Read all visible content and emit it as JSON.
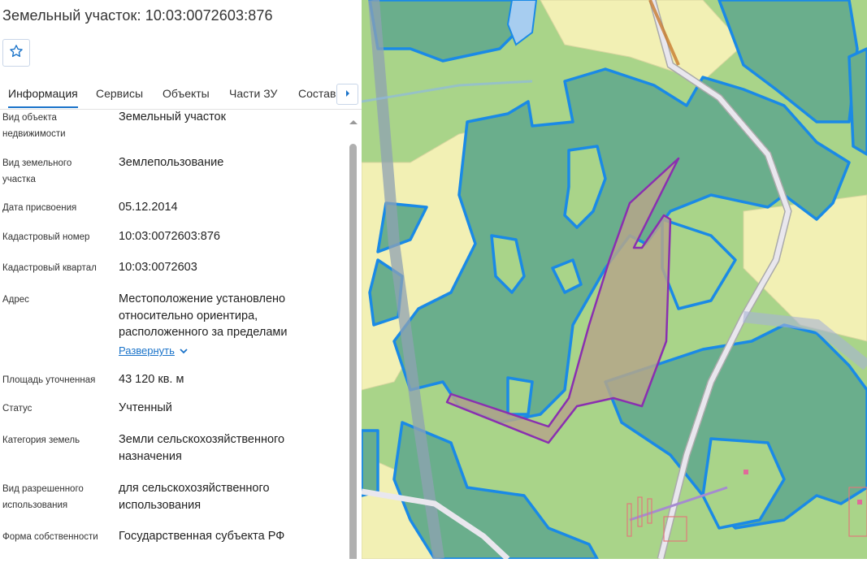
{
  "panel": {
    "title": "Земельный участок: 10:03:0072603:876",
    "favorite_icon": "star-outline-icon",
    "tabs": [
      {
        "label": "Информация",
        "active": true
      },
      {
        "label": "Сервисы",
        "active": false
      },
      {
        "label": "Объекты",
        "active": false
      },
      {
        "label": "Части ЗУ",
        "active": false
      },
      {
        "label": "Состав",
        "active": false
      }
    ],
    "tabs_next_icon": "caret-right-icon",
    "fields": [
      {
        "label": "Вид объекта недвижимости",
        "value": "Земельный участок"
      },
      {
        "label": "Вид земельного участка",
        "value": "Землепользование"
      },
      {
        "label": "Дата присвоения",
        "value": "05.12.2014"
      },
      {
        "label": "Кадастровый номер",
        "value": "10:03:0072603:876"
      },
      {
        "label": "Кадастровый квартал",
        "value": "10:03:0072603"
      },
      {
        "label": "Адрес",
        "value": "Местоположение установлено относительно ориентира, расположенного за пределами"
      },
      {
        "label": "Площадь уточненная",
        "value": "43 120 кв. м"
      },
      {
        "label": "Статус",
        "value": "Учтенный"
      },
      {
        "label": "Категория земель",
        "value": "Земли сельскохозяйственного назначения"
      },
      {
        "label": "Вид разрешенного использования",
        "value": "для сельскохозяйственного использования"
      },
      {
        "label": "Форма собственности",
        "value": "Государственная субъекта РФ"
      }
    ],
    "expand_link": "Развернуть",
    "expand_icon": "chevron-down-icon"
  },
  "map": {
    "colors": {
      "forest": "#6aae8c",
      "meadow": "#a9d489",
      "field": "#f2f0b4",
      "outline": "#1a8ae6",
      "parcel_fill": "#b5a68a",
      "parcel_outline": "#8a2fb0",
      "road": "#e9e7ee",
      "water": "#a7cdf0",
      "railway": "#8fa1b3"
    }
  }
}
